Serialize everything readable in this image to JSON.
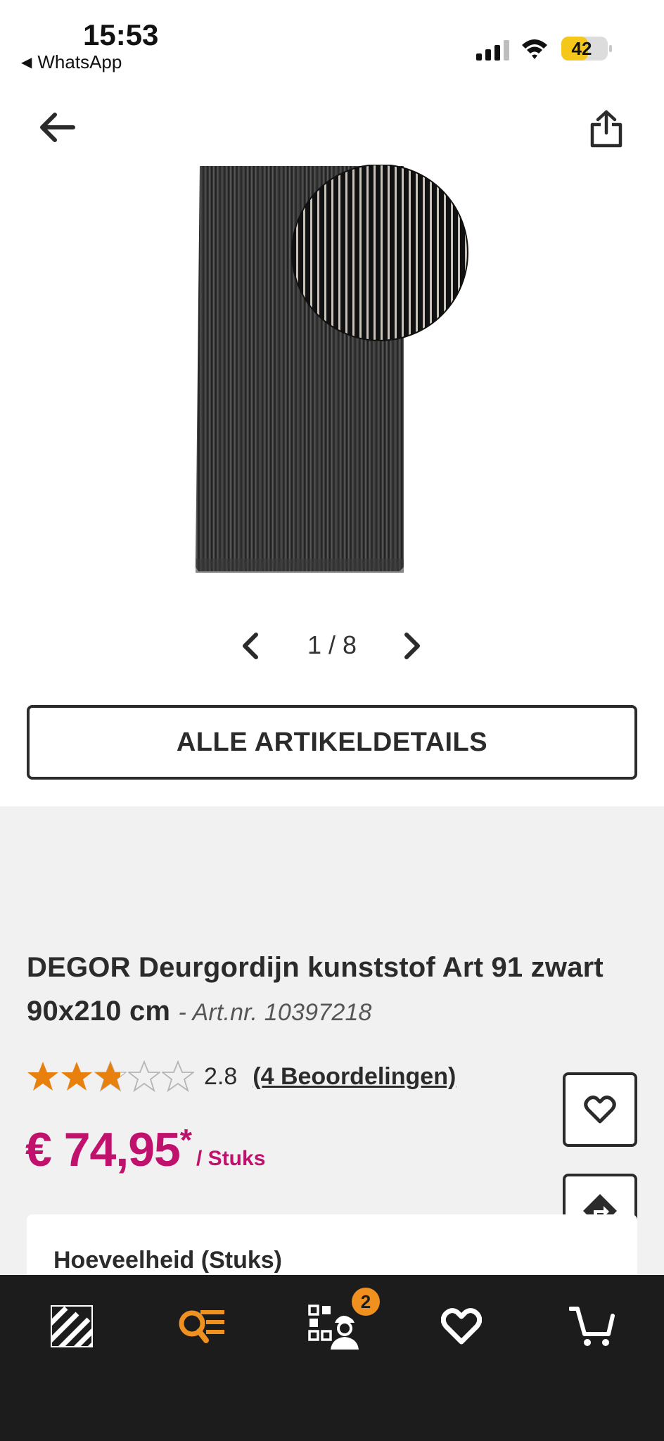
{
  "status_bar": {
    "time": "15:53",
    "back_app": "WhatsApp",
    "battery": "42",
    "battery_level": 0.42
  },
  "gallery": {
    "counter": "1 / 8",
    "current": 1,
    "total": 8
  },
  "details_button": "ALLE ARTIKELDETAILS",
  "product": {
    "title": "DEGOR Deurgordijn kunststof Art 91 zwart 90x210 cm",
    "artnr": "- Art.nr. 10397218",
    "rating_value": "2.8",
    "rating_stars": 2.8,
    "reviews": "(4 Beoordelingen)",
    "price": "€ 74,95",
    "price_asterisk": "*",
    "price_unit": "/ Stuks",
    "quantity_label": "Hoeveelheid (Stuks)"
  },
  "bottom_nav": {
    "badge": "2"
  },
  "colors": {
    "price": "#c0116c",
    "star": "#e8800e",
    "accent_orange": "#f0901e",
    "nav_background": "#1c1c1c"
  },
  "icons": [
    "back-arrow-icon",
    "share-icon",
    "chevron-left-icon",
    "chevron-right-icon",
    "heart-icon",
    "route-icon",
    "hornbach-logo-icon",
    "search-list-icon",
    "store-service-icon",
    "cart-icon"
  ]
}
